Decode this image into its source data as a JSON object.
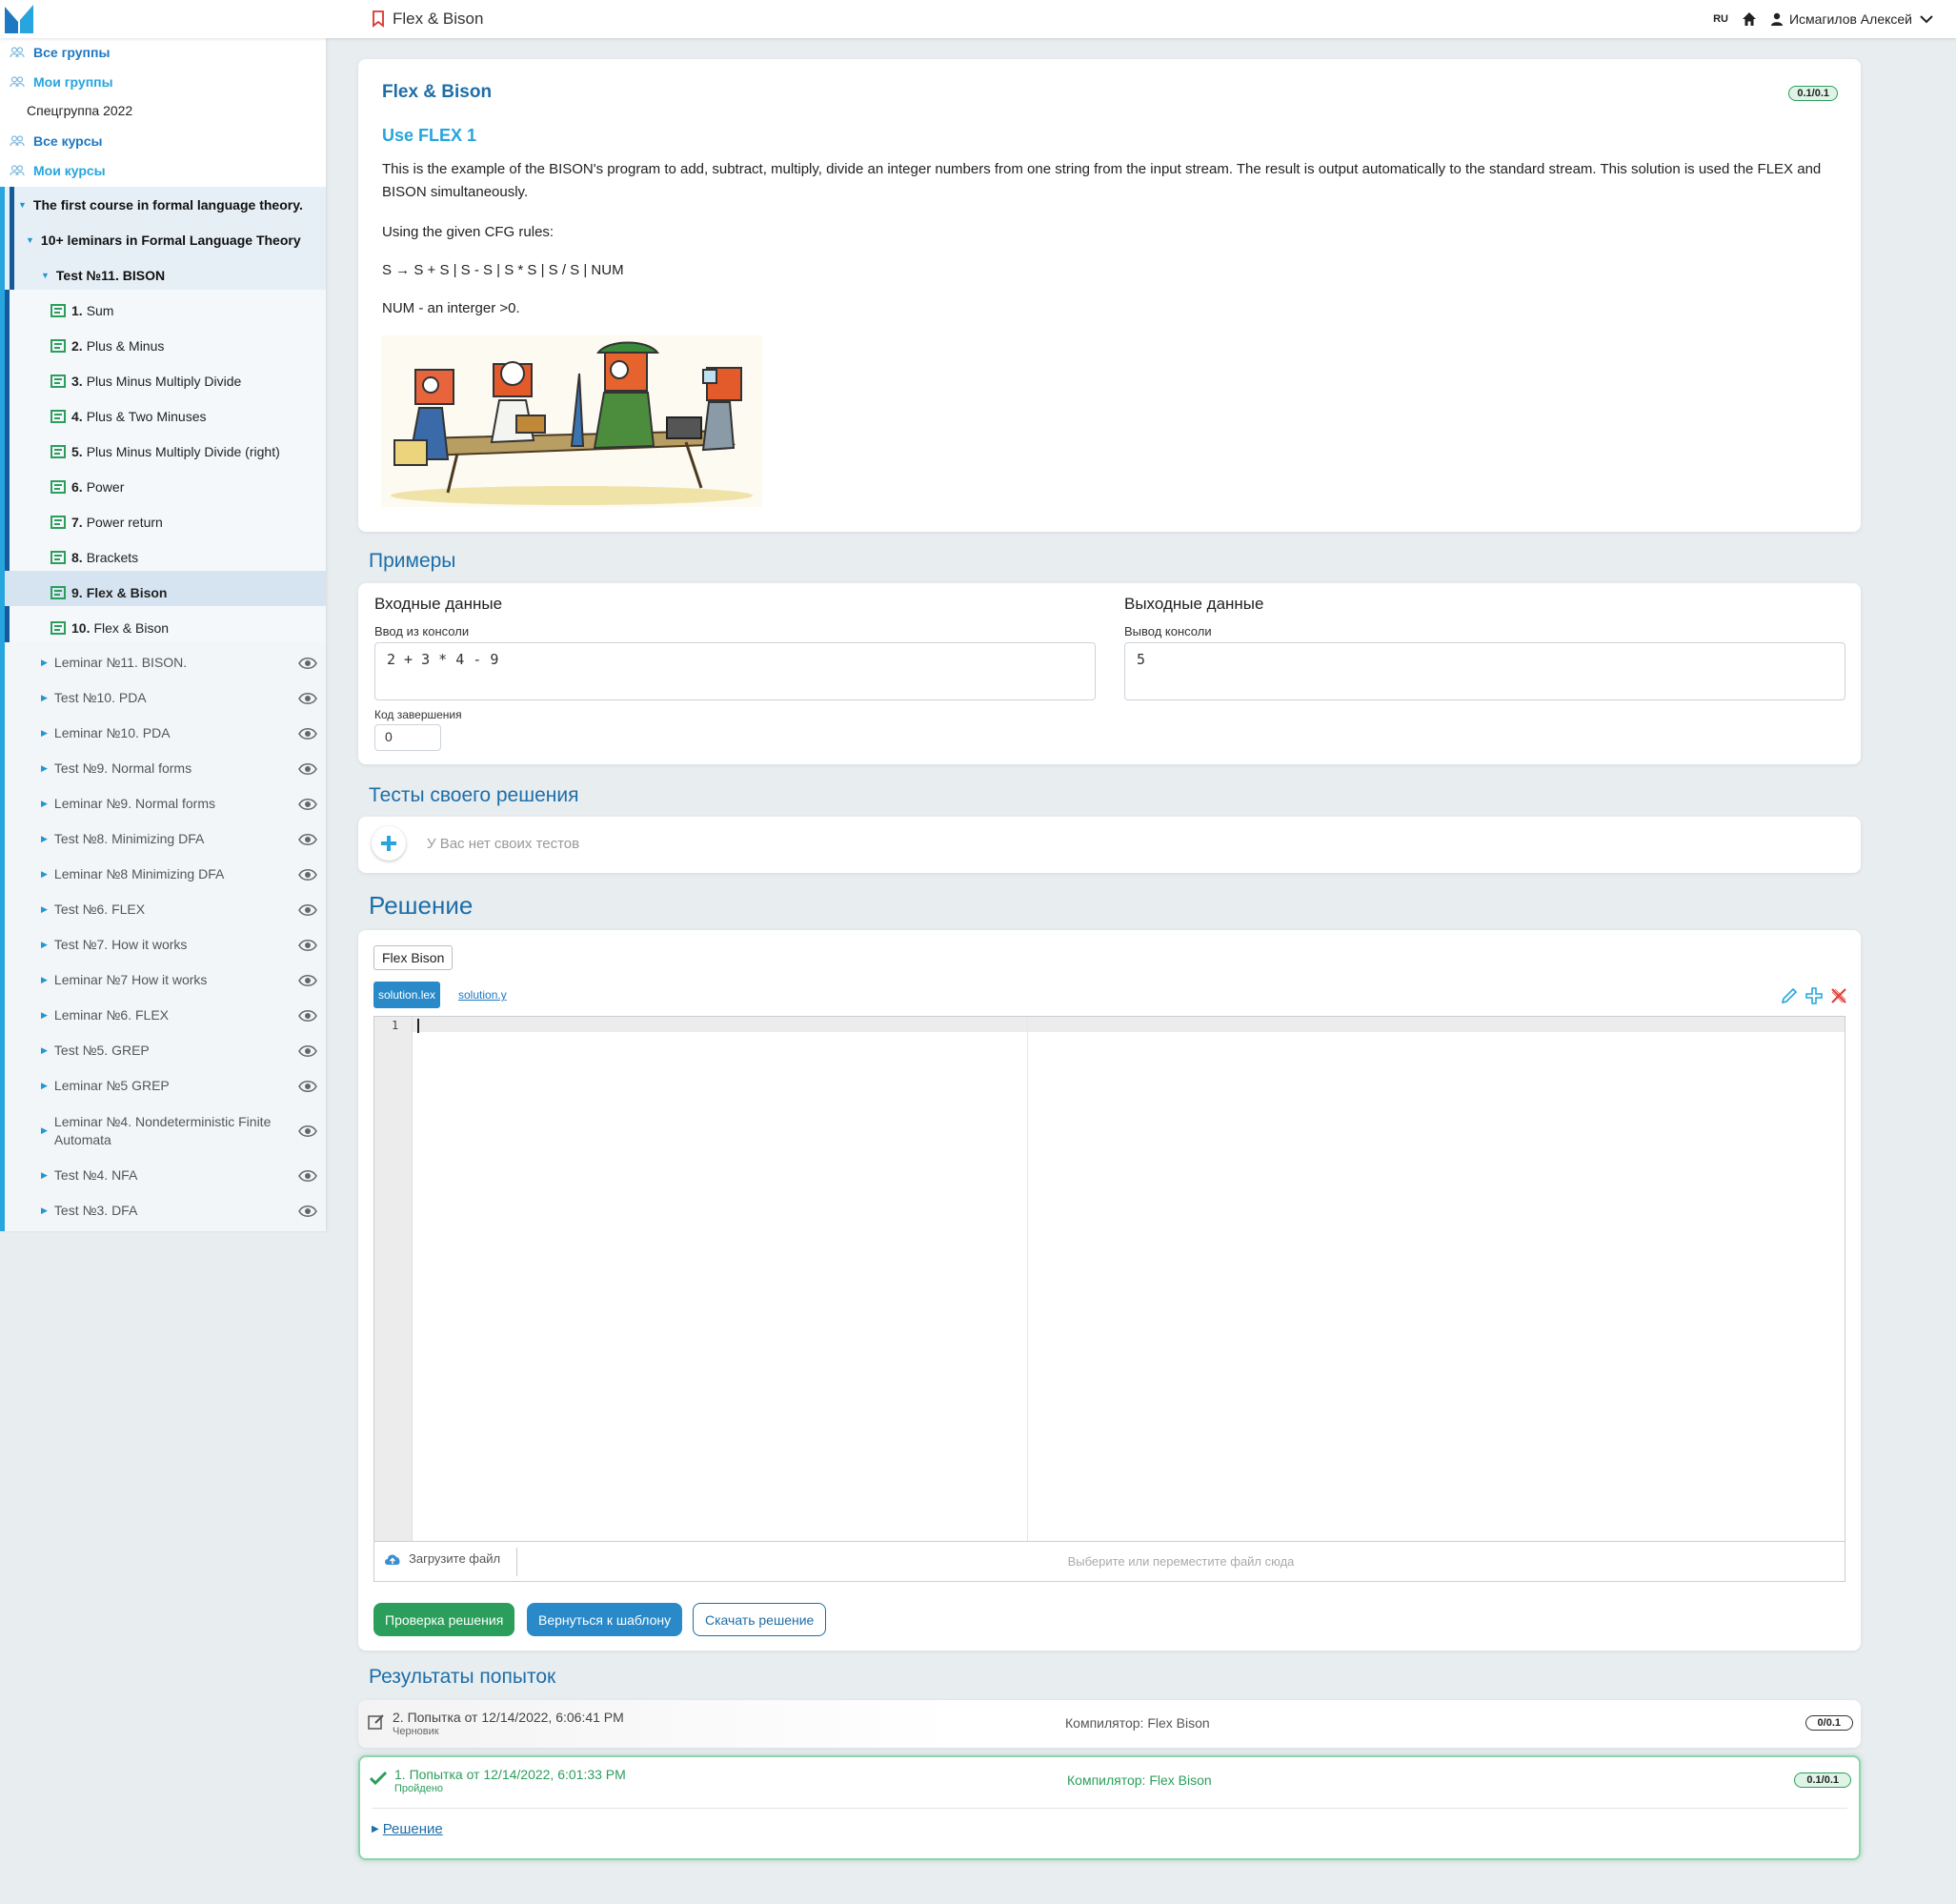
{
  "header": {
    "title": "Flex & Bison",
    "lang": "RU",
    "user": "Исмагилов Алексей"
  },
  "sidebar": {
    "nav": [
      {
        "label": "Все группы"
      },
      {
        "label": "Мои группы"
      }
    ],
    "group": "Спецгруппа 2022",
    "nav2": [
      {
        "label": "Все курсы"
      },
      {
        "label": "Мои курсы"
      }
    ],
    "course": "The first course in formal language theory.",
    "module": "10+ leminars in Formal Language Theory",
    "unit": "Test №11. BISON",
    "tasks": [
      {
        "num": "1.",
        "title": "Sum"
      },
      {
        "num": "2.",
        "title": "Plus & Minus"
      },
      {
        "num": "3.",
        "title": "Plus Minus Multiply Divide"
      },
      {
        "num": "4.",
        "title": "Plus & Two Minuses"
      },
      {
        "num": "5.",
        "title": "Plus Minus Multiply Divide (right)"
      },
      {
        "num": "6.",
        "title": "Power"
      },
      {
        "num": "7.",
        "title": "Power return"
      },
      {
        "num": "8.",
        "title": "Brackets"
      },
      {
        "num": "9.",
        "title": "Flex & Bison"
      },
      {
        "num": "10.",
        "title": "Flex & Bison"
      }
    ],
    "units": [
      "Leminar №11. BISON.",
      "Test №10. PDA",
      "Leminar №10. PDA",
      "Test №9. Normal forms",
      "Leminar №9. Normal forms",
      "Test №8. Minimizing DFA",
      "Leminar №8 Minimizing DFA",
      "Test №6. FLEX",
      "Test №7. How it works",
      "Leminar №7 How it works",
      "Leminar №6. FLEX",
      "Test №5. GREP",
      "Leminar №5 GREP",
      "Leminar №4. Nondeterministic Finite Automata",
      "Test №4. NFA",
      "Test №3. DFA"
    ]
  },
  "task": {
    "title": "Flex & Bison",
    "score": "0.1/0.1",
    "subtitle": "Use FLEX 1",
    "p1": "This is the example of the BISON's program to add, subtract, multiply, divide an integer numbers  from one string from the input stream. The result is output automatically to the standard stream. This solution is used the FLEX and BISON simultaneously.",
    "p2": "Using the given CFG rules:",
    "p3": "S → S + S | S - S | S * S | S / S | NUM",
    "p4": "NUM - an interger >0."
  },
  "examples": {
    "section": "Примеры",
    "input_h": "Входные данные",
    "input_label": "Ввод из консоли",
    "input_value": "2 + 3 * 4 - 9",
    "output_h": "Выходные данные",
    "output_label": "Вывод консоли",
    "output_value": "5",
    "code_label": "Код завершения",
    "code_value": "0"
  },
  "tests": {
    "section": "Тесты своего решения",
    "empty": "У Вас нет своих тестов"
  },
  "solution": {
    "section": "Решение",
    "compiler": "Flex Bison",
    "tab_active": "solution.lex",
    "tab_other": "solution.y",
    "line1": "1",
    "upload_btn": "Загрузите файл",
    "upload_placeholder": "Выберите или переместите файл сюда",
    "btn_check": "Проверка решения",
    "btn_template": "Вернуться к шаблону",
    "btn_download": "Скачать решение"
  },
  "results": {
    "section": "Результаты попыток",
    "attempts": [
      {
        "title": "2. Попытка от 12/14/2022, 6:06:41 PM",
        "status": "Черновик",
        "compiler": "Компилятор: Flex Bison",
        "score": "0/0.1"
      },
      {
        "title": "1. Попытка от 12/14/2022, 6:01:33 PM",
        "status": "Пройдено",
        "compiler": "Компилятор: Flex Bison",
        "score": "0.1/0.1",
        "link": "Решение"
      }
    ]
  },
  "colors": {
    "accent": "#1d6ea8",
    "link": "#26a5de",
    "success": "#2b9e5b",
    "primary_button": "#2a8ac9"
  }
}
